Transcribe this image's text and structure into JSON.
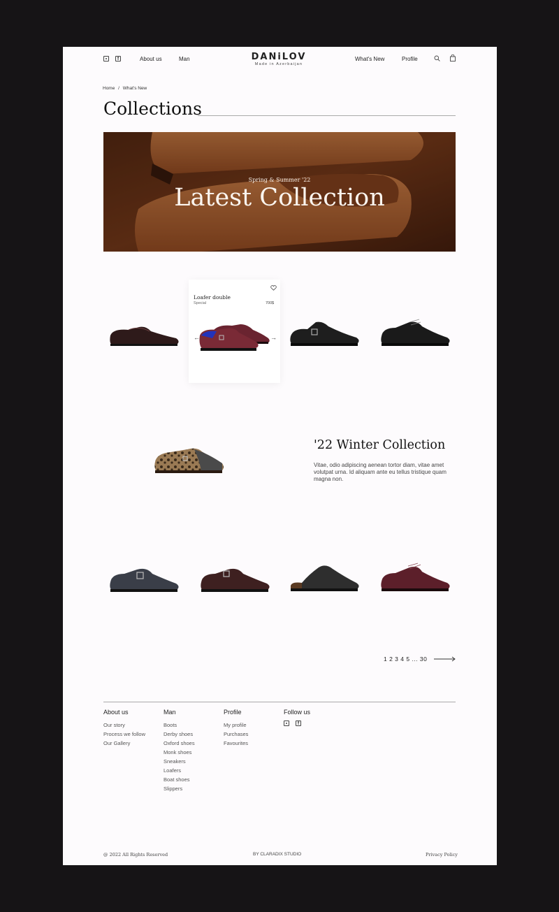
{
  "header": {
    "nav_left": [
      "About us",
      "Man"
    ],
    "logo": "DANiLOV",
    "logo_sub": "Made in Azerbaijan",
    "nav_right": [
      "What's New",
      "Profile"
    ],
    "icons": [
      "instagram-icon",
      "facebook-icon",
      "search-icon",
      "bag-icon"
    ]
  },
  "breadcrumb": {
    "items": [
      "Home",
      "What's New"
    ],
    "sep": "/"
  },
  "page_title": "Collections",
  "hero": {
    "eyebrow": "Spring & Summer '22",
    "title": "Latest Collection"
  },
  "featured": {
    "name": "Loafer double",
    "subtitle": "Special",
    "price": "700$"
  },
  "winter": {
    "title": "'22 Winter Collection",
    "body": "Vitae, odio adipiscing aenean tortor diam, vitae amet volutpat urna. Id aliquam ante eu tellus tristique quam magna non."
  },
  "pagination": {
    "label": "1 2 3 4 5 ... 30"
  },
  "footer": {
    "columns": [
      {
        "heading": "About us",
        "links": [
          "Our story",
          "Process we follow",
          "Our Gallery"
        ]
      },
      {
        "heading": "Man",
        "links": [
          "Boots",
          "Derby shoes",
          "Oxford shoes",
          "Monk shoes",
          "Sneakers",
          "Loafers",
          "Boat shoes",
          "Slippers"
        ]
      },
      {
        "heading": "Profile",
        "links": [
          "My profile",
          "Purchases",
          "Favourites"
        ]
      },
      {
        "heading": "Follow us",
        "links": []
      }
    ],
    "copyright": "@ 2022 All Rights Reserved",
    "credit": "BY CLARADIX STUDIO",
    "privacy": "Privacy Policy"
  },
  "colors": {
    "page_bg": "#fdfbfd",
    "frame_bg": "#161416",
    "hero_brown": "#6e3a1c",
    "burgundy": "#6a2430"
  }
}
